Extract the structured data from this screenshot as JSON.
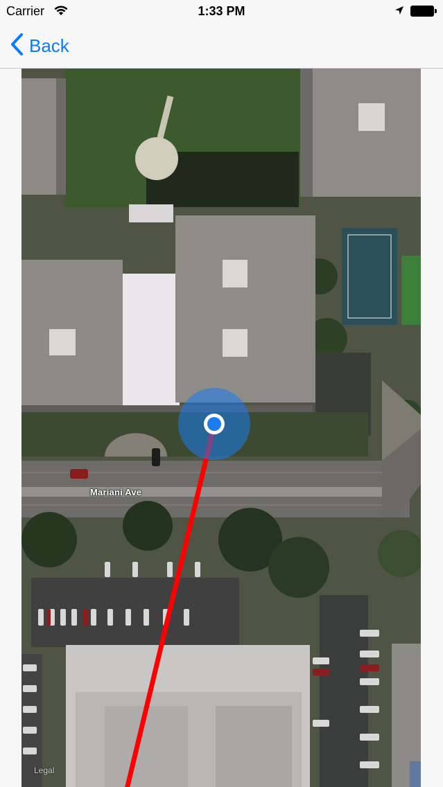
{
  "status_bar": {
    "carrier": "Carrier",
    "time": "1:33 PM",
    "wifi_icon": "wifi-icon",
    "location_icon": "location-arrow-icon",
    "battery_icon": "battery-icon"
  },
  "nav": {
    "back_label": "Back",
    "back_icon": "chevron-left-icon",
    "tint_color": "#0a7aff"
  },
  "map": {
    "map_type": "satellite",
    "street_label": "Mariani Ave",
    "legal_label": "Legal",
    "user_location_color": "#1a7cf0",
    "route_line_color": "#ff0000"
  }
}
